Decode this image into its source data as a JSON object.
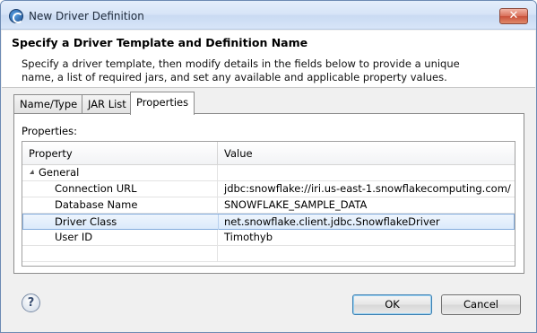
{
  "window": {
    "title": "New Driver Definition",
    "close_glyph": "✕"
  },
  "header": {
    "title": "Specify a Driver Template and Definition Name",
    "description": "Specify a driver template, then modify details in the fields below to provide a unique name, a list of required jars, and set any available and applicable property values."
  },
  "tabs": [
    {
      "label": "Name/Type",
      "active": false
    },
    {
      "label": "JAR List",
      "active": false
    },
    {
      "label": "Properties",
      "active": true
    }
  ],
  "properties": {
    "label": "Properties:",
    "columns": [
      "Property",
      "Value"
    ],
    "group": "General",
    "rows": [
      {
        "name": "Connection URL",
        "value": "jdbc:snowflake://iri.us-east-1.snowflakecomputing.com/",
        "selected": false
      },
      {
        "name": "Database Name",
        "value": "SNOWFLAKE_SAMPLE_DATA",
        "selected": false
      },
      {
        "name": "Driver Class",
        "value": "net.snowflake.client.jdbc.SnowflakeDriver",
        "selected": true
      },
      {
        "name": "User ID",
        "value": "Timothyb",
        "selected": false
      }
    ]
  },
  "footer": {
    "help_glyph": "?",
    "ok_label": "OK",
    "cancel_label": "Cancel"
  },
  "icons": {
    "app": "eclipse-icon",
    "help": "help-icon",
    "expand": "expand-triangle-icon"
  }
}
